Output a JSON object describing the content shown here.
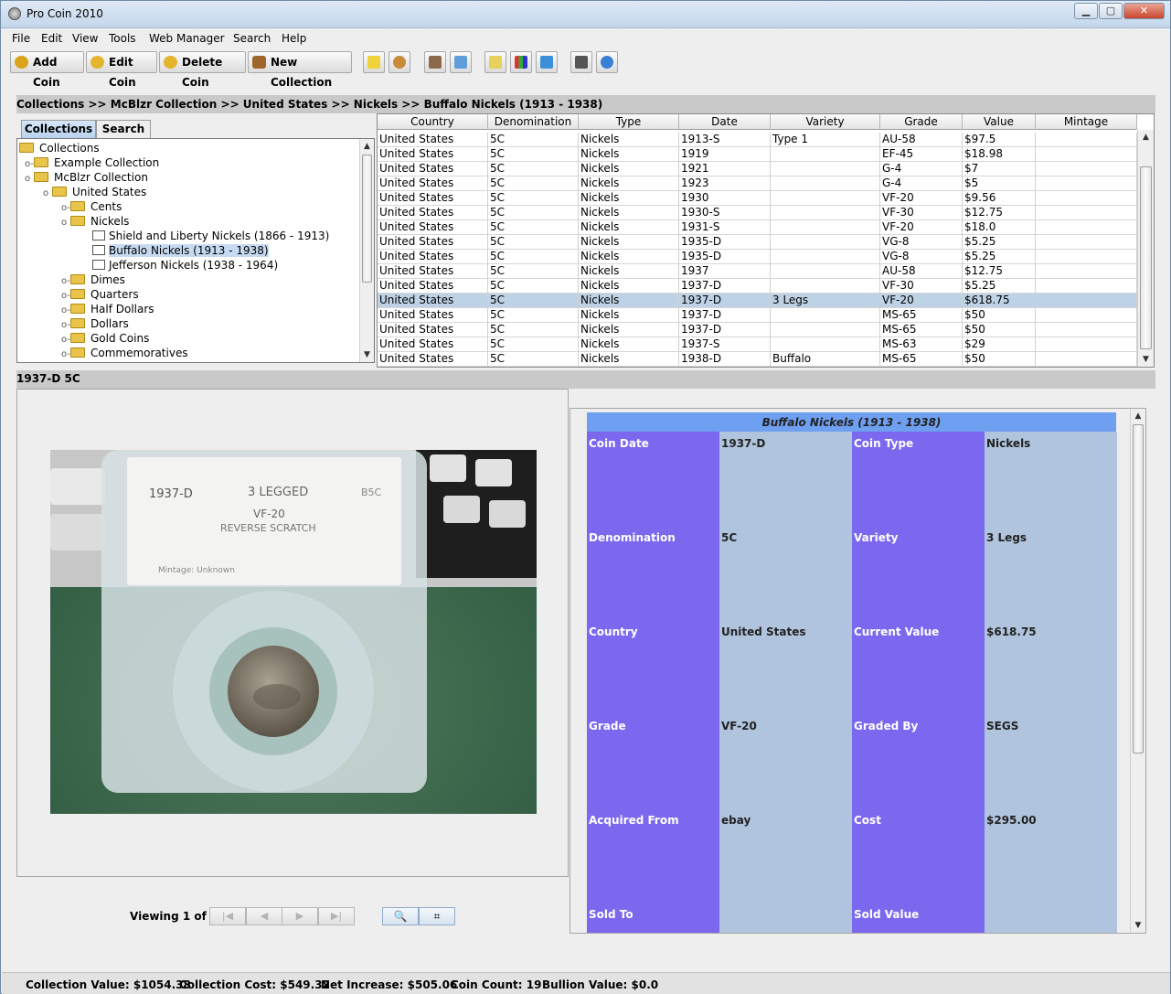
{
  "window": {
    "title": "Pro Coin 2010"
  },
  "menu": [
    "File",
    "Edit",
    "View",
    "Tools",
    "Web Manager",
    "Search",
    "Help"
  ],
  "toolbar": {
    "add_coin": "Add Coin",
    "edit_coin": "Edit Coin",
    "delete_coin": "Delete Coin",
    "new_collection": "New Collection"
  },
  "breadcrumb": "Collections >> McBlzr Collection >> United States >> Nickels >> Buffalo Nickels (1913 - 1938)",
  "tabs": {
    "collections": "Collections",
    "search": "Search"
  },
  "tree": [
    "Collections",
    "Example Collection",
    "McBlzr Collection",
    "United States",
    "Cents",
    "Nickels",
    "Shield and Liberty Nickels (1866 - 1913)",
    "Buffalo Nickels (1913 - 1938)",
    "Jefferson Nickels (1938 - 1964)",
    "Dimes",
    "Quarters",
    "Half Dollars",
    "Dollars",
    "Gold Coins",
    "Commemoratives"
  ],
  "table": {
    "columns": [
      "Country",
      "Denomination",
      "Type",
      "Date",
      "Variety",
      "Grade",
      "Value",
      "Mintage"
    ],
    "rows": [
      [
        "United States",
        "5C",
        "Nickels",
        "1913-S",
        "Type 1",
        "AU-58",
        "$97.5",
        ""
      ],
      [
        "United States",
        "5C",
        "Nickels",
        "1919",
        "",
        "EF-45",
        "$18.98",
        ""
      ],
      [
        "United States",
        "5C",
        "Nickels",
        "1921",
        "",
        "G-4",
        "$7",
        ""
      ],
      [
        "United States",
        "5C",
        "Nickels",
        "1923",
        "",
        "G-4",
        "$5",
        ""
      ],
      [
        "United States",
        "5C",
        "Nickels",
        "1930",
        "",
        "VF-20",
        "$9.56",
        ""
      ],
      [
        "United States",
        "5C",
        "Nickels",
        "1930-S",
        "",
        "VF-30",
        "$12.75",
        ""
      ],
      [
        "United States",
        "5C",
        "Nickels",
        "1931-S",
        "",
        "VF-20",
        "$18.0",
        ""
      ],
      [
        "United States",
        "5C",
        "Nickels",
        "1935-D",
        "",
        "VG-8",
        "$5.25",
        ""
      ],
      [
        "United States",
        "5C",
        "Nickels",
        "1935-D",
        "",
        "VG-8",
        "$5.25",
        ""
      ],
      [
        "United States",
        "5C",
        "Nickels",
        "1937",
        "",
        "AU-58",
        "$12.75",
        ""
      ],
      [
        "United States",
        "5C",
        "Nickels",
        "1937-D",
        "",
        "VF-30",
        "$5.25",
        ""
      ],
      [
        "United States",
        "5C",
        "Nickels",
        "1937-D",
        "3 Legs",
        "VF-20",
        "$618.75",
        ""
      ],
      [
        "United States",
        "5C",
        "Nickels",
        "1937-D",
        "",
        "MS-65",
        "$50",
        ""
      ],
      [
        "United States",
        "5C",
        "Nickels",
        "1937-D",
        "",
        "MS-65",
        "$50",
        ""
      ],
      [
        "United States",
        "5C",
        "Nickels",
        "1937-S",
        "",
        "MS-63",
        "$29",
        ""
      ],
      [
        "United States",
        "5C",
        "Nickels",
        "1938-D",
        "Buffalo",
        "MS-65",
        "$50",
        ""
      ]
    ]
  },
  "selected_label": "1937-D 5C",
  "slab_text": {
    "date": "1937-D",
    "variety": "3 LEGGED",
    "grade": "VF-20",
    "note": "REVERSE SCRATCH",
    "mintage": "Mintage: Unknown",
    "code": "B5C"
  },
  "viewing": "Viewing 1 of 1",
  "detail": {
    "title": "Buffalo Nickels (1913 - 1938)",
    "left": [
      {
        "label": "Coin Date",
        "value": "1937-D"
      },
      {
        "label": "Denomination",
        "value": "5C"
      },
      {
        "label": "Country",
        "value": "United States"
      },
      {
        "label": "Grade",
        "value": "VF-20"
      },
      {
        "label": "Acquired From",
        "value": "ebay"
      },
      {
        "label": "Sold To",
        "value": ""
      }
    ],
    "right": [
      {
        "label": "Coin Type",
        "value": "Nickels"
      },
      {
        "label": "Variety",
        "value": "3 Legs"
      },
      {
        "label": "Current Value",
        "value": "$618.75"
      },
      {
        "label": "Graded By",
        "value": "SEGS"
      },
      {
        "label": "Cost",
        "value": "$295.00"
      },
      {
        "label": "Sold Value",
        "value": ""
      }
    ]
  },
  "status": {
    "collection_value": "Collection Value: $1054.38",
    "collection_cost": "Collection Cost: $549.32",
    "net_increase": "Net Increase: $505.06",
    "coin_count": "Coin Count: 19",
    "bullion_value": "Bullion Value: $0.0"
  },
  "colors": {
    "label_col": "#7b68ee",
    "value_col": "#b0c4de",
    "detail_title": "#6f9ff0",
    "selected_row": "#bed2e6"
  }
}
